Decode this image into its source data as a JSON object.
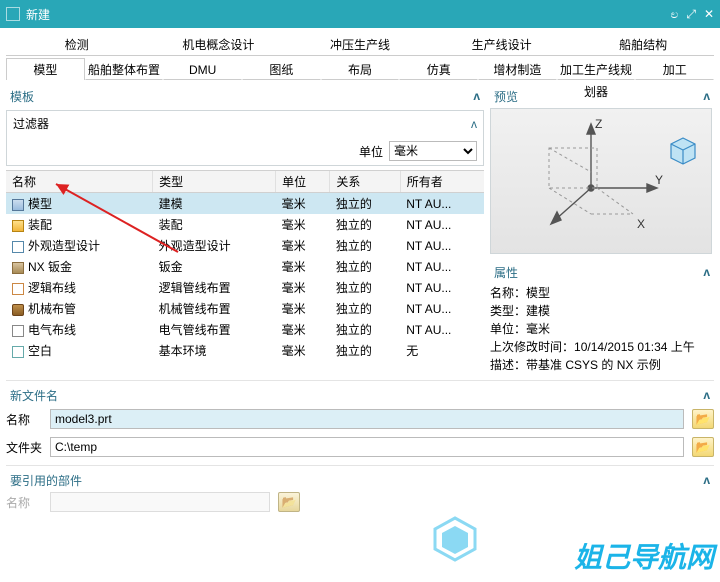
{
  "window": {
    "title": "新建"
  },
  "titlebar_icons": {
    "restore": "⟳",
    "min": "⤢",
    "close": "✕"
  },
  "tabs1": [
    "检测",
    "机电概念设计",
    "冲压生产线",
    "生产线设计",
    "船舶结构"
  ],
  "tabs2": [
    "模型",
    "船舶整体布置",
    "DMU",
    "图纸",
    "布局",
    "仿真",
    "增材制造",
    "加工生产线规划器",
    "加工"
  ],
  "active_tab2": 0,
  "template_section": {
    "title": "模板",
    "filter_label": "过滤器",
    "unit_label": "单位",
    "unit_value": "毫米"
  },
  "columns": [
    "名称",
    "类型",
    "单位",
    "关系",
    "所有者"
  ],
  "rows": [
    {
      "icon": "model",
      "name": "模型",
      "type": "建模",
      "unit": "毫米",
      "rel": "独立的",
      "owner": "NT AU...",
      "selected": true
    },
    {
      "icon": "asm",
      "name": "装配",
      "type": "装配",
      "unit": "毫米",
      "rel": "独立的",
      "owner": "NT AU..."
    },
    {
      "icon": "shape",
      "name": "外观造型设计",
      "type": "外观造型设计",
      "unit": "毫米",
      "rel": "独立的",
      "owner": "NT AU..."
    },
    {
      "icon": "nx",
      "name": "NX 钣金",
      "type": "钣金",
      "unit": "毫米",
      "rel": "独立的",
      "owner": "NT AU..."
    },
    {
      "icon": "route",
      "name": "逻辑布线",
      "type": "逻辑管线布置",
      "unit": "毫米",
      "rel": "独立的",
      "owner": "NT AU..."
    },
    {
      "icon": "mech",
      "name": "机械布管",
      "type": "机械管线布置",
      "unit": "毫米",
      "rel": "独立的",
      "owner": "NT AU..."
    },
    {
      "icon": "elec",
      "name": "电气布线",
      "type": "电气管线布置",
      "unit": "毫米",
      "rel": "独立的",
      "owner": "NT AU..."
    },
    {
      "icon": "blank",
      "name": "空白",
      "type": "基本环境",
      "unit": "毫米",
      "rel": "独立的",
      "owner": "无"
    }
  ],
  "preview_section": {
    "title": "预览"
  },
  "props_section": {
    "title": "属性",
    "rows": {
      "name_label": "名称：",
      "name_value": "模型",
      "type_label": "类型：",
      "type_value": "建模",
      "unit_label": "单位：",
      "unit_value": "毫米",
      "mod_label": "上次修改时间：",
      "mod_value": "10/14/2015 01:34 上午",
      "desc_label": "描述：",
      "desc_value": "带基准 CSYS 的 NX 示例"
    }
  },
  "newfile_section": {
    "title": "新文件名",
    "name_label": "名称",
    "name_value": "model3.prt",
    "folder_label": "文件夹",
    "folder_value": "C:\\temp"
  },
  "refpart_section": {
    "title": "要引用的部件",
    "name_label": "名称"
  },
  "watermark": "姐己导航网",
  "chart_data": {
    "type": "table",
    "headers": [
      "名称",
      "类型",
      "单位",
      "关系",
      "所有者"
    ],
    "rows": [
      [
        "模型",
        "建模",
        "毫米",
        "独立的",
        "NT AU..."
      ],
      [
        "装配",
        "装配",
        "毫米",
        "独立的",
        "NT AU..."
      ],
      [
        "外观造型设计",
        "外观造型设计",
        "毫米",
        "独立的",
        "NT AU..."
      ],
      [
        "NX 钣金",
        "钣金",
        "毫米",
        "独立的",
        "NT AU..."
      ],
      [
        "逻辑布线",
        "逻辑管线布置",
        "毫米",
        "独立的",
        "NT AU..."
      ],
      [
        "机械布管",
        "机械管线布置",
        "毫米",
        "独立的",
        "NT AU..."
      ],
      [
        "电气布线",
        "电气管线布置",
        "毫米",
        "独立的",
        "NT AU..."
      ],
      [
        "空白",
        "基本环境",
        "毫米",
        "独立的",
        "无"
      ]
    ]
  }
}
